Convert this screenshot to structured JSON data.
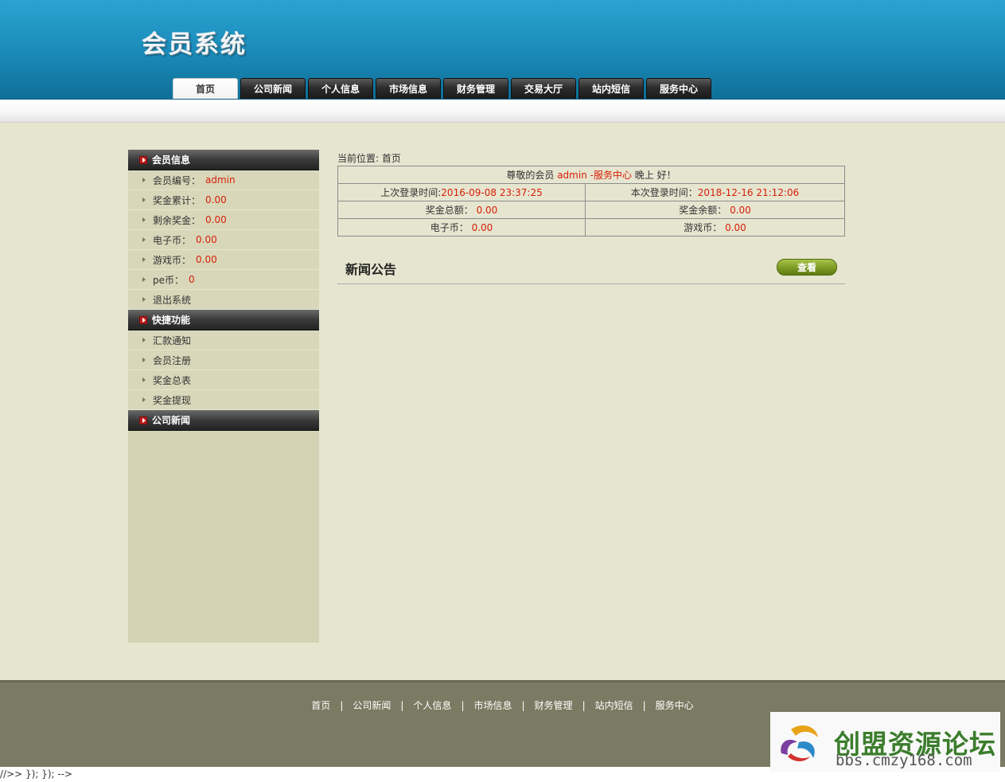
{
  "header": {
    "logo": "会员系统"
  },
  "nav": [
    "首页",
    "公司新闻",
    "个人信息",
    "市场信息",
    "财务管理",
    "交易大厅",
    "站内短信",
    "服务中心"
  ],
  "sidebar": {
    "member_info": {
      "title": "会员信息",
      "items": [
        {
          "label": "会员编号：",
          "value": "admin"
        },
        {
          "label": "奖金累计：",
          "value": "0.00"
        },
        {
          "label": "剩余奖金：",
          "value": "0.00"
        },
        {
          "label": "电子币：",
          "value": "0.00"
        },
        {
          "label": "游戏币：",
          "value": "0.00"
        },
        {
          "label": "pe币：",
          "value": "0"
        },
        {
          "label": "退出系统",
          "value": ""
        }
      ]
    },
    "quick": {
      "title": "快捷功能",
      "items": [
        "汇款通知",
        "会员注册",
        "奖金总表",
        "奖金提现"
      ]
    },
    "company_news": {
      "title": "公司新闻"
    }
  },
  "main": {
    "crumb": "当前位置: 首页",
    "greeting": {
      "prefix": "尊敬的会员",
      "user": " admin -服务中心",
      "suffix": "晚上 好！"
    },
    "last_login": {
      "label": "上次登录时间:",
      "value": "2016-09-08 23:37:25"
    },
    "this_login": {
      "label": "本次登录时间：",
      "value": "2018-12-16 21:12:06"
    },
    "bonus_total": {
      "label": "奖金总额：",
      "value": "0.00"
    },
    "bonus_balance": {
      "label": "奖金余额：",
      "value": "0.00"
    },
    "ecoin": {
      "label": "电子币：",
      "value": "0.00"
    },
    "gamecoin": {
      "label": "游戏币：",
      "value": "0.00"
    },
    "news_title": "新闻公告",
    "view_button": "查看"
  },
  "footer": {
    "links": [
      "首页",
      "公司新闻",
      "个人信息",
      "市场信息",
      "财务管理",
      "站内短信",
      "服务中心"
    ],
    "separator": "|"
  },
  "bottom_text": "//>> }); }); -->",
  "watermark": {
    "title": "创盟资源论坛",
    "url": "bbs.cmzy168.com"
  },
  "colors": {
    "header_blue": "#1a8ab8",
    "accent_red": "#d81e06",
    "button_green": "#7d9b24",
    "page_bg": "#e6e5d0"
  }
}
